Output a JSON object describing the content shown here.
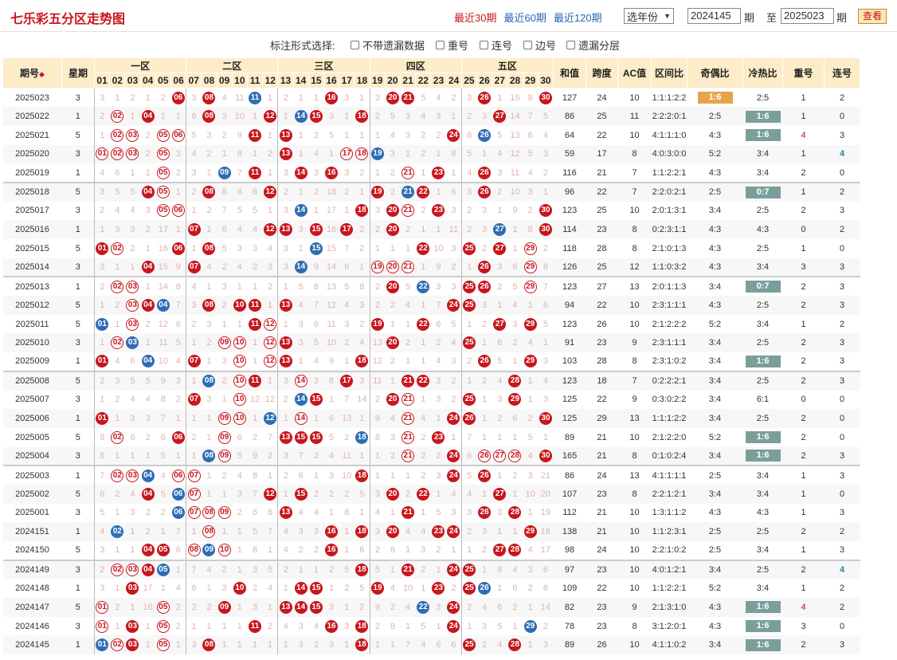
{
  "title": "七乐彩五分区走势图",
  "periods": [
    "最近30期",
    "最近60期",
    "最近120期"
  ],
  "active_period": 0,
  "year_select": "选年份",
  "from_value": "2024145",
  "from_suffix": "期",
  "to_label": "至",
  "to_value": "2025023",
  "to_suffix": "期",
  "view_button": "查看",
  "options_label": "标注形式选择:",
  "options": [
    "不带遗漏数据",
    "重号",
    "连号",
    "边号",
    "遗漏分层"
  ],
  "zones": [
    "一区",
    "二区",
    "三区",
    "四区",
    "五区"
  ],
  "headers": {
    "period": "期号",
    "sort_icon": "◆",
    "weekday": "星期",
    "sum": "和值",
    "span": "跨度",
    "ac": "AC值",
    "zone_ratio": "区间比",
    "odd_even": "奇偶比",
    "hot_cold": "冷热比",
    "repeat": "重号",
    "consecutive": "连号"
  },
  "numbers": [
    "01",
    "02",
    "03",
    "04",
    "05",
    "06",
    "07",
    "08",
    "09",
    "10",
    "11",
    "12",
    "13",
    "14",
    "15",
    "16",
    "17",
    "18",
    "19",
    "20",
    "21",
    "22",
    "23",
    "24",
    "25",
    "26",
    "27",
    "28",
    "29",
    "30"
  ],
  "colors": {
    "red": "#c8161d",
    "blue": "#2d6db5",
    "header": "#fcecc8",
    "tag_green": "#7a9f9a",
    "tag_orange": "#e6a54a"
  },
  "rows": [
    {
      "p": "2025023",
      "w": "3",
      "c": "3,1,2,1,2,R06,3,R08,4,11,B11,1,2,1,1,R16,3,1,3,R20,R21,5,4,2,3,R26,1,15,8,R30",
      "sum": "127",
      "span": "24",
      "ac": "10",
      "zr": "1:1:1:2:2",
      "oe": "1:6",
      "oeTag": "y",
      "hc": "2:5",
      "hcTag": "",
      "rep": "1",
      "con": "2"
    },
    {
      "p": "2025022",
      "w": "1",
      "c": "2,O02,1,R04,1,1,6,R08,3,10,1,R12,1,B14,R15,3,1,R18,2,5,3,4,3,1,2,3,R27,14,7,5",
      "sum": "86",
      "span": "25",
      "ac": "11",
      "zr": "2:2:2:0:1",
      "oe": "2:5",
      "hc": "1:6",
      "hcTag": "g",
      "rep": "1",
      "con": "0"
    },
    {
      "p": "2025021",
      "w": "5",
      "c": "1,O02,O03,2,O05,O06,5,3,2,9,R11,1,R13,1,2,5,1,1,1,4,3,2,2,R24,6,B26,5,13,6,4",
      "sum": "64",
      "span": "22",
      "ac": "10",
      "zr": "4:1:1:1:0",
      "oe": "4:3",
      "hc": "1:6",
      "hcTag": "g",
      "rep": "4",
      "repRed": true,
      "con": "3"
    },
    {
      "p": "2025020",
      "w": "3",
      "c": "O01,O02,O03,2,O05,3,4,2,1,8,1,2,R13,1,4,1,O17,O18,B19,3,1,2,1,8,5,1,4,12,5,3",
      "sum": "59",
      "span": "17",
      "ac": "8",
      "zr": "4:0:3:0:0",
      "oe": "5:2",
      "hc": "3:4",
      "rep": "1",
      "con": "4",
      "conTeal": true
    },
    {
      "p": "2025019",
      "w": "1",
      "c": "4,6,1,1,O05,2,3,1,B09,7,R11,1,3,R14,3,R16,3,2,1,2,O21,1,R23,1,4,R26,3,11,4,2",
      "sum": "116",
      "span": "21",
      "ac": "7",
      "zr": "1:1:2:2:1",
      "oe": "4:3",
      "hc": "3:4",
      "rep": "2",
      "con": "0"
    },
    {
      "p": "2025018",
      "w": "5",
      "c": "3,5,5,R04,O05,1,2,R08,8,6,6,R12,2,1,2,18,2,1,R19,2,B21,R22,1,6,3,R26,2,10,3,1",
      "sum": "96",
      "span": "22",
      "ac": "7",
      "zr": "2:2:0:2:1",
      "oe": "2:5",
      "hc": "0:7",
      "hcTag": "g",
      "rep": "1",
      "con": "2",
      "sep": true
    },
    {
      "p": "2025017",
      "w": "3",
      "c": "2,4,4,3,O05,O06,1,2,7,5,5,1,3,B14,1,17,1,R18,3,R20,O21,2,R23,3,2,3,1,9,2,R30",
      "sum": "123",
      "span": "25",
      "ac": "10",
      "zr": "2:0:1:3:1",
      "oe": "3:4",
      "hc": "2:5",
      "rep": "2",
      "con": "3"
    },
    {
      "p": "2025016",
      "w": "1",
      "c": "1,3,3,2,17,1,R07,1,6,4,4,R12,R13,3,R15,16,R17,2,2,R20,2,1,1,11,2,3,B27,1,8,R30",
      "sum": "114",
      "span": "23",
      "ac": "8",
      "zr": "0:2:3:1:1",
      "oe": "4:3",
      "hc": "4:3",
      "rep": "0",
      "con": "2"
    },
    {
      "p": "2025015",
      "w": "5",
      "c": "R01,O02,2,1,16,R06,1,R08,5,3,3,4,3,1,B15,15,7,2,1,1,1,R22,10,3,R25,2,R27,1,O29,2",
      "sum": "118",
      "span": "28",
      "ac": "8",
      "zr": "2:1:0:1:3",
      "oe": "4:3",
      "hc": "2:5",
      "rep": "1",
      "con": "0"
    },
    {
      "p": "2025014",
      "w": "3",
      "c": "3,1,1,R04,15,9,R07,4,2,4,2,3,3,B14,9,14,6,1,O19,O20,O21,1,9,2,1,R26,3,6,O29,8",
      "sum": "126",
      "span": "25",
      "ac": "12",
      "zr": "1:1:0:3:2",
      "oe": "4:3",
      "hc": "3:4",
      "rep": "3",
      "con": "3"
    },
    {
      "p": "2025013",
      "w": "1",
      "c": "2,O02,O03,1,14,8,4,1,3,1,1,2,1,5,8,13,5,8,2,R20,5,B22,3,3,R25,R26,2,5,O29,7",
      "sum": "123",
      "span": "27",
      "ac": "13",
      "zr": "2:0:1:1:3",
      "oe": "3:4",
      "hc": "0:7",
      "hcTag": "g",
      "rep": "2",
      "con": "3",
      "sep": true
    },
    {
      "p": "2025012",
      "w": "5",
      "c": "1,2,O03,R04,B04,7,3,R08,2,R10,R11,1,R13,4,7,12,4,3,2,2,4,1,7,R24,R25,3,1,4,1,6",
      "sum": "94",
      "span": "22",
      "ac": "10",
      "zr": "2:3:1:1:1",
      "oe": "4:3",
      "hc": "2:5",
      "rep": "2",
      "con": "3"
    },
    {
      "p": "2025011",
      "w": "5",
      "c": "B01,1,O03,2,12,6,2,3,1,1,R11,O12,1,3,6,11,3,2,R19,1,1,R22,6,5,1,2,R27,3,R29,5",
      "sum": "123",
      "span": "26",
      "ac": "10",
      "zr": "2:1:2:2:2",
      "oe": "5:2",
      "hc": "3:4",
      "rep": "1",
      "con": "2"
    },
    {
      "p": "2025010",
      "w": "3",
      "c": "1,O02,B03,1,11,5,1,2,O09,O10,1,O12,R13,3,5,10,2,4,13,R20,2,1,2,4,R25,1,6,2,4,1",
      "sum": "91",
      "span": "23",
      "ac": "9",
      "zr": "2:3:1:1:1",
      "oe": "3:4",
      "hc": "2:5",
      "rep": "2",
      "con": "3"
    },
    {
      "p": "2025009",
      "w": "1",
      "c": "R01,4,6,B04,10,4,R07,1,3,O10,1,O12,R13,1,4,9,1,R18,12,2,1,1,4,3,2,R26,5,1,R29,3",
      "sum": "103",
      "span": "28",
      "ac": "8",
      "zr": "2:3:1:0:2",
      "oe": "3:4",
      "hc": "1:6",
      "hcTag": "g",
      "rep": "2",
      "con": "3"
    },
    {
      "p": "2025008",
      "w": "5",
      "c": "2,3,5,5,9,3,1,B08,2,O10,R11,1,3,O14,3,8,R17,3,11,1,R21,R22,3,2,1,2,4,R28,1,4",
      "sum": "123",
      "span": "18",
      "ac": "7",
      "zr": "0:2:2:2:1",
      "oe": "3:4",
      "hc": "2:5",
      "rep": "2",
      "con": "3",
      "sep": true
    },
    {
      "p": "2025007",
      "w": "3",
      "c": "1,2,4,4,8,2,R07,3,1,O10,12,12,2,B14,R15,1,7,14,2,R20,O21,1,3,2,R25,1,3,R29,1,3",
      "sum": "125",
      "span": "22",
      "ac": "9",
      "zr": "0:3:0:2:2",
      "oe": "3:4",
      "hc": "6:1",
      "rep": "0",
      "con": "0"
    },
    {
      "p": "2025006",
      "w": "1",
      "c": "R01,1,3,3,7,1,1,1,O09,O10,1,B12,1,O14,1,6,13,1,9,4,O21,4,1,R24,R26,1,2,6,2,R30",
      "sum": "125",
      "span": "29",
      "ac": "13",
      "zr": "1:1:1:2:2",
      "oe": "3:4",
      "hc": "2:5",
      "rep": "2",
      "con": "0"
    },
    {
      "p": "2025005",
      "w": "5",
      "c": "9,O02,6,2,6,R06,2,1,O09,6,2,7,R13,R15,R15,5,2,B18,8,3,O21,2,R23,1,7,1,1,1,5,1",
      "sum": "89",
      "span": "21",
      "ac": "10",
      "zr": "2:1:2:2:0",
      "oe": "5:2",
      "hc": "1:6",
      "hcTag": "g",
      "rep": "2",
      "con": "0"
    },
    {
      "p": "2025004",
      "w": "3",
      "c": "8,1,1,1,5,1,1,B08,O09,5,9,2,3,7,2,4,11,1,1,2,O21,2,2,R24,6,O26,O27,O28,4,R30",
      "sum": "165",
      "span": "21",
      "ac": "8",
      "zr": "0:1:0:2:4",
      "oe": "3:4",
      "hc": "1:6",
      "hcTag": "g",
      "rep": "2",
      "con": "3"
    },
    {
      "p": "2025003",
      "w": "1",
      "c": "7,O02,O03,B04,4,O06,O07,1,2,4,8,1,2,6,1,3,10,R18,1,1,1,2,3,R24,5,R26,1,2,3,21",
      "sum": "86",
      "span": "24",
      "ac": "13",
      "zr": "4:1:1:1:1",
      "oe": "2:5",
      "hc": "3:4",
      "rep": "1",
      "con": "3",
      "sep": true
    },
    {
      "p": "2025002",
      "w": "5",
      "c": "6,2,4,R04,5,B06,O07,1,1,3,7,R12,1,R15,2,2,2,5,3,R20,2,R22,1,4,4,1,R27,1,10,20",
      "sum": "107",
      "span": "23",
      "ac": "8",
      "zr": "2:2:1:2:1",
      "oe": "3:4",
      "hc": "3:4",
      "rep": "1",
      "con": "0"
    },
    {
      "p": "2025001",
      "w": "3",
      "c": "5,1,3,2,2,B06,O07,O08,O09,2,6,8,R13,4,4,1,8,1,4,1,R21,1,5,3,3,R26,3,R28,1,19",
      "sum": "112",
      "span": "21",
      "ac": "10",
      "zr": "1:3:1:1:2",
      "oe": "4:3",
      "hc": "4:3",
      "rep": "1",
      "con": "3"
    },
    {
      "p": "2024151",
      "w": "1",
      "c": "4,B02,1,2,1,7,1,O08,1,1,5,7,4,3,3,R16,1,R18,3,R20,4,4,R23,R24,2,3,1,1,R29,18",
      "sum": "138",
      "span": "21",
      "ac": "10",
      "zr": "1:1:2:3:1",
      "oe": "2:5",
      "hc": "2:5",
      "rep": "2",
      "con": "2"
    },
    {
      "p": "2024150",
      "w": "5",
      "c": "3,1,1,R04,R05,6,O08,B09,O10,1,8,1,4,2,2,R16,1,6,2,6,1,3,2,1,1,2,R27,R28,4,17",
      "sum": "98",
      "span": "24",
      "ac": "10",
      "zr": "2:2:1:0:2",
      "oe": "2:5",
      "hc": "3:4",
      "rep": "1",
      "con": "3"
    },
    {
      "p": "2024149",
      "w": "3",
      "c": "2,O02,O03,R04,B05,1,7,4,2,1,3,5,2,1,1,2,5,R18,5,1,R21,2,1,R24,R25,1,8,4,3,6",
      "sum": "97",
      "span": "23",
      "ac": "10",
      "zr": "4:0:1:2:1",
      "oe": "3:4",
      "hc": "2:5",
      "rep": "2",
      "con": "4",
      "conTeal": true,
      "sep": true
    },
    {
      "p": "2024148",
      "w": "1",
      "c": "3,1,R03,17,1,4,6,1,3,R10,2,4,1,R14,R15,1,2,5,R19,4,10,1,R23,2,R25,B26,1,6,2,6",
      "sum": "109",
      "span": "22",
      "ac": "10",
      "zr": "1:1:2:2:1",
      "oe": "5:2",
      "hc": "3:4",
      "rep": "1",
      "con": "2"
    },
    {
      "p": "2024147",
      "w": "5",
      "c": "O01,2,1,16,O05,2,2,2,R09,1,3,1,R13,R14,R15,3,1,2,9,2,4,B22,3,R24,2,4,6,2,1,14",
      "sum": "82",
      "span": "23",
      "ac": "9",
      "zr": "2:1:3:1:0",
      "oe": "4:3",
      "hc": "1:6",
      "hcTag": "g",
      "rep": "4",
      "repRed": true,
      "con": "2"
    },
    {
      "p": "2024146",
      "w": "3",
      "c": "O01,1,R03,1,O05,2,1,1,1,1,R11,2,4,3,4,R16,3,R18,2,8,1,5,1,R24,1,3,5,1,B29,2",
      "sum": "78",
      "span": "23",
      "ac": "8",
      "zr": "3:1:2:0:1",
      "oe": "4:3",
      "hc": "1:6",
      "hcTag": "g",
      "rep": "3",
      "con": "0"
    },
    {
      "p": "2024145",
      "w": "1",
      "c": "B01,O02,R03,1,O05,1,3,R08,1,1,1,1,1,3,2,3,1,R18,1,1,7,4,6,6,R25,2,4,R28,1,3",
      "sum": "89",
      "span": "26",
      "ac": "10",
      "zr": "4:1:1:0:2",
      "oe": "3:4",
      "hc": "1:6",
      "hcTag": "g",
      "rep": "2",
      "con": "3"
    }
  ]
}
